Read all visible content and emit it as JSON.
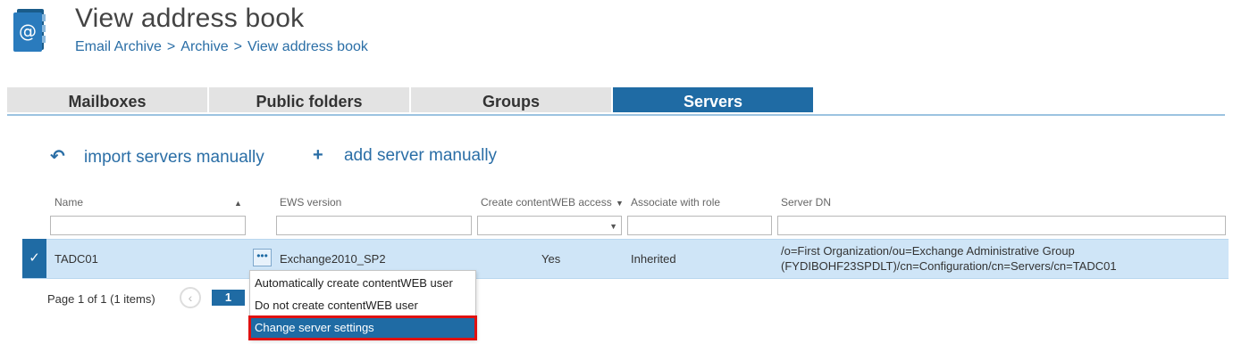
{
  "header": {
    "title": "View address book",
    "breadcrumb": [
      "Email Archive",
      "Archive",
      "View address book"
    ],
    "separator": ">"
  },
  "tabs": [
    {
      "label": "Mailboxes",
      "active": false
    },
    {
      "label": "Public folders",
      "active": false
    },
    {
      "label": "Groups",
      "active": false
    },
    {
      "label": "Servers",
      "active": true
    }
  ],
  "actions": {
    "import_icon": "↶",
    "import_label": "import servers manually",
    "add_icon": "+",
    "add_label": "add server manually"
  },
  "grid": {
    "columns": [
      "Name",
      "EWS version",
      "Create contentWEB access",
      "Associate with role",
      "Server DN"
    ],
    "sort_caret": "▲",
    "dropdown_caret": "▼",
    "rows": [
      {
        "name": "TADC01",
        "ews_version": "Exchange2010_SP2",
        "create_access": "Yes",
        "role": "Inherited",
        "server_dn_line1": "/o=First Organization/ou=Exchange Administrative Group",
        "server_dn_line2": "(FYDIBOHF23SPDLT)/cn=Configuration/cn=Servers/cn=TADC01",
        "selected": true
      }
    ],
    "row_check": "✓",
    "row_menu_glyph": "•••"
  },
  "pager": {
    "summary": "Page 1 of 1 (1 items)",
    "prev_glyph": "‹",
    "current_page": "1"
  },
  "context_menu": {
    "items": [
      "Automatically create contentWEB user",
      "Do not create contentWEB user",
      "Change server settings"
    ],
    "highlighted_index": 2
  },
  "colors": {
    "accent": "#1f6ba4",
    "link": "#2a6ea6",
    "row_selected": "#cfe5f7",
    "highlight_border": "#e01010"
  },
  "icons": {
    "app": "address-book-icon"
  }
}
